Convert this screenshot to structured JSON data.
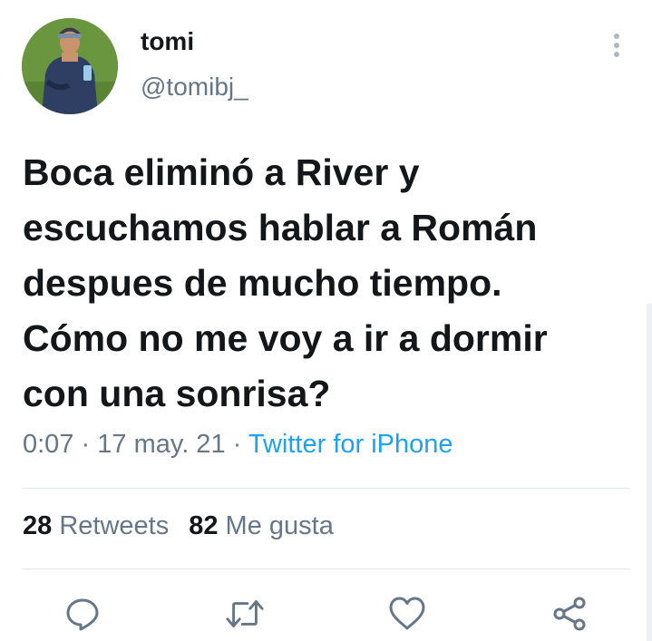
{
  "tweet": {
    "display_name": "tomi",
    "handle": "@tomibj_",
    "text": "Boca eliminó a River y\nescuchamos hablar a Román\ndespues de mucho tiempo.\nCómo no me voy a ir a dormir\ncon una sonrisa?",
    "time": "0:07",
    "separator": "·",
    "date": "17 may. 21",
    "source": "Twitter for iPhone"
  },
  "stats": {
    "retweets_count": "28",
    "retweets_label": "Retweets",
    "likes_count": "82",
    "likes_label": "Me gusta"
  },
  "icons": {
    "more": "vertical-ellipsis-icon",
    "reply": "reply-icon",
    "retweet": "retweet-icon",
    "like": "heart-icon",
    "share": "share-icon"
  },
  "colors": {
    "text": "#14171a",
    "secondary": "#657786",
    "link": "#1da1f2",
    "divider": "#e1e8ed"
  }
}
